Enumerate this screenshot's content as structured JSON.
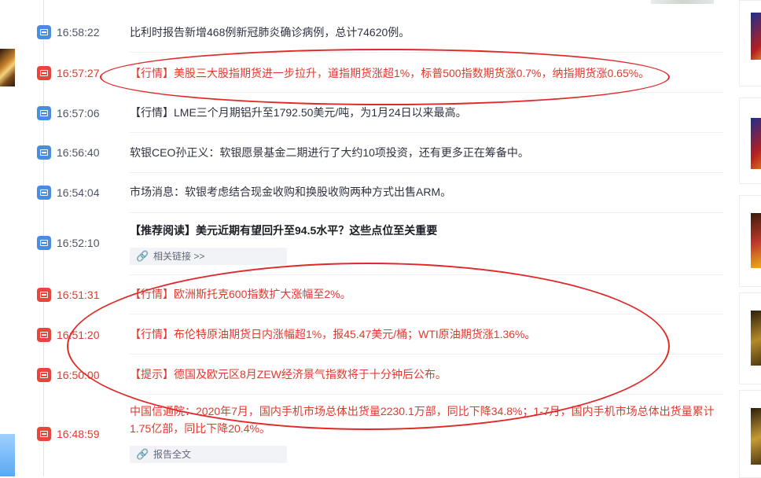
{
  "feed": {
    "items": [
      {
        "time": "16:58:22",
        "type": "normal",
        "text": "比利时报告新增468例新冠肺炎确诊病例，总计74620例。"
      },
      {
        "time": "16:57:27",
        "type": "important",
        "text": "【行情】美股三大股指期货进一步拉升，道指期货涨超1%，标普500指数期货涨0.7%，纳指期货涨0.65%。"
      },
      {
        "time": "16:57:06",
        "type": "normal",
        "text": "【行情】LME三个月期铝升至1792.50美元/吨，为1月24日以来最高。"
      },
      {
        "time": "16:56:40",
        "type": "normal",
        "text": "软银CEO孙正义：软银愿景基金二期进行了大约10项投资，还有更多正在筹备中。"
      },
      {
        "time": "16:54:04",
        "type": "normal",
        "text": "市场消息：软银考虑结合现金收购和换股收购两种方式出售ARM。"
      },
      {
        "time": "16:52:10",
        "type": "bold",
        "text": "【推荐阅读】美元近期有望回升至94.5水平？这些点位至关重要",
        "link": "相关链接 >>"
      },
      {
        "time": "16:51:31",
        "type": "important",
        "text": "【行情】欧洲斯托克600指数扩大涨幅至2%。"
      },
      {
        "time": "16:51:20",
        "type": "important",
        "text": "【行情】布伦特原油期货日内涨幅超1%，报45.47美元/桶；WTI原油期货涨1.36%。"
      },
      {
        "time": "16:50:00",
        "type": "important",
        "text": "【提示】德国及欧元区8月ZEW经济景气指数将于十分钟后公布。"
      },
      {
        "time": "16:48:59",
        "type": "important",
        "text": "中国信通院：2020年7月，国内手机市场总体出货量2230.1万部，同比下降34.8%；1-7月，国内手机市场总体出货量累计1.75亿部，同比下降20.4%。",
        "link": "报告全文"
      }
    ]
  },
  "icons": {
    "timeline_normal": "news-icon-blue",
    "timeline_important": "news-icon-red",
    "link": "link-icon"
  },
  "colors": {
    "important": "#e0392f",
    "normal_icon": "#4a8de0",
    "annotation": "#e02a2a"
  }
}
